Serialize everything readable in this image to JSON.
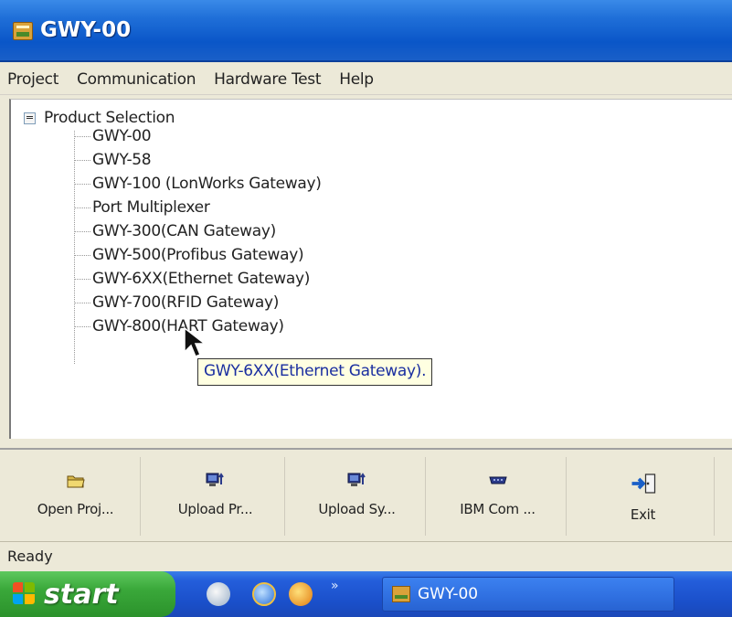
{
  "window": {
    "title": "GWY-00",
    "icon": "gwy-app-icon"
  },
  "menu": {
    "items": [
      "Project",
      "Communication",
      "Hardware Test",
      "Help"
    ]
  },
  "tree": {
    "root_label": "Product Selection",
    "root_state": "expanded",
    "children": [
      "GWY-00",
      "GWY-58",
      "GWY-100 (LonWorks Gateway)",
      "Port Multiplexer",
      "GWY-300(CAN Gateway)",
      "GWY-500(Profibus Gateway)",
      "GWY-6XX(Ethernet Gateway)",
      "GWY-700(RFID Gateway)",
      "GWY-800(HART Gateway)"
    ]
  },
  "tooltip": {
    "text": "GWY-6XX(Ethernet Gateway)."
  },
  "toolbar": {
    "buttons": [
      {
        "label": "Open Proj...",
        "icon": "folder-open-icon"
      },
      {
        "label": "Upload Pr...",
        "icon": "computer-upload-icon"
      },
      {
        "label": "Upload Sy...",
        "icon": "computer-upload-icon"
      },
      {
        "label": "IBM Com ...",
        "icon": "serial-port-icon"
      },
      {
        "label": "Exit",
        "icon": "exit-door-icon"
      }
    ]
  },
  "status": {
    "text": "Ready"
  },
  "taskbar": {
    "start_label": "start",
    "quick_launch": [
      "browser-icon",
      "ie-icon",
      "media-icon"
    ],
    "chevron": "»",
    "task_label": "GWY-00",
    "colors": {
      "start": "#3aa83a",
      "bar": "#245edb"
    }
  }
}
